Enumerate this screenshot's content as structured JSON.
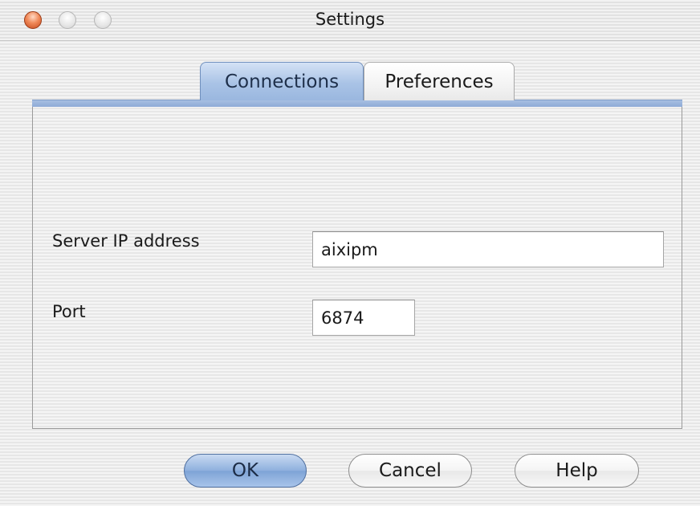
{
  "window": {
    "title": "Settings"
  },
  "tabs": [
    {
      "label": "Connections",
      "active": true
    },
    {
      "label": "Preferences",
      "active": false
    }
  ],
  "form": {
    "server": {
      "label": "Server IP address",
      "value": "aixipm"
    },
    "port": {
      "label": "Port",
      "value": "6874"
    }
  },
  "buttons": {
    "ok": "OK",
    "cancel": "Cancel",
    "help": "Help"
  },
  "colors": {
    "accent": "#9ab7df",
    "close_button": "#e8784a"
  }
}
